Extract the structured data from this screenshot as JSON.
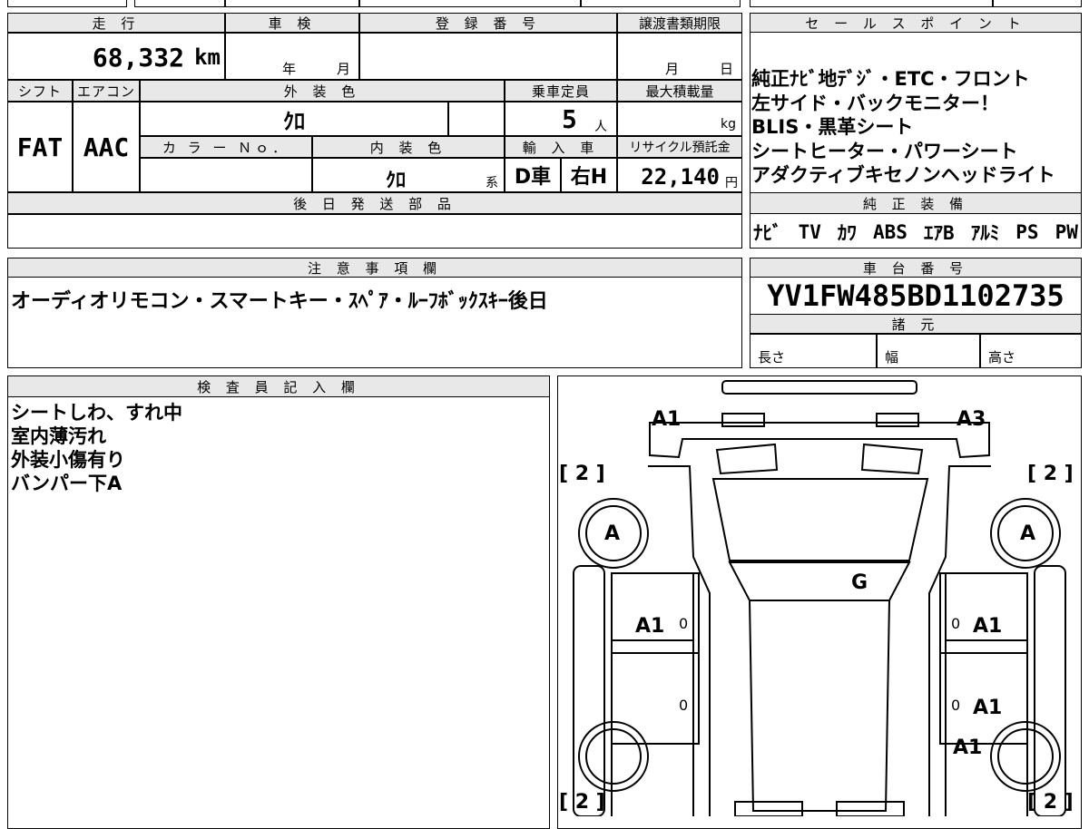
{
  "top_strip": "",
  "vehicle": {
    "mileage_label": "走 行",
    "mileage_value": "68,332",
    "mileage_unit": "km",
    "inspection_label": "車 検",
    "inspection_year": "年",
    "inspection_month": "月",
    "registration_label": "登 録 番 号",
    "transfer_label": "譲渡書類期限",
    "transfer_month": "月",
    "transfer_day": "日",
    "shift_label": "シフト",
    "shift_value": "FAT",
    "ac_label": "エアコン",
    "ac_value": "AAC",
    "exterior_label": "外 装 色",
    "exterior_value": "ｸﾛ",
    "capacity_label": "乗車定員",
    "capacity_value": "5",
    "capacity_unit": "人",
    "load_label": "最大積載量",
    "load_unit": "kg",
    "color_no_label": "カ ラ ー Ｎｏ．",
    "interior_label": "内 装 色",
    "interior_value": "ｸﾛ",
    "interior_suffix": "系",
    "import_label": "輸 入 車",
    "import_d": "D車",
    "import_h": "右H",
    "recycle_label": "リサイクル預託金",
    "recycle_value": "22,140",
    "recycle_unit": "円",
    "later_parts_label": "後 日 発 送 部 品"
  },
  "sales": {
    "label": "セ ー ル ス ポ イ ン ト",
    "lines": [
      "純正ﾅﾋﾞ地ﾃﾞｼﾞ・ETC・フロント",
      "左サイド・バックモニター！",
      "BLIS・黒革シート",
      "シートヒーター・パワーシート",
      "アダクティブキセノンヘッドライト"
    ]
  },
  "equipment": {
    "label": "純 正 装 備",
    "items": [
      "ﾅﾋﾞ",
      "TV",
      "ｶﾜ",
      "ABS",
      "ｴｱB",
      "ｱﾙﾐ",
      "PS",
      "PW"
    ]
  },
  "notes": {
    "label": "注 意 事 項 欄",
    "text": "オーディオリモコン・スマートキー・ｽﾍﾟｱ・ﾙｰﾌﾎﾞｯｸｽｷｰ後日"
  },
  "chassis": {
    "label": "車 台 番 号",
    "value": "YV1FW485BD1102735",
    "spec_label": "諸 元",
    "length_label": "長さ",
    "width_label": "幅",
    "height_label": "高さ"
  },
  "inspector": {
    "label": "検 査 員 記 入 欄",
    "lines": [
      "シートしわ、すれ中",
      "室内薄汚れ",
      "外装小傷有り",
      "バンパー下A"
    ]
  },
  "diagram": {
    "a1_front_left": "A1",
    "a3_front_right": "A3",
    "tire_tl": "[ 2 ]",
    "tire_tr": "[ 2 ]",
    "tire_bl": "[ 2 ]",
    "tire_br": "[ 2 ]",
    "wheel_left": "A",
    "wheel_right": "A",
    "windshield": "G",
    "door_fl": "A1",
    "door_fr": "A1",
    "door_rr": "A1",
    "rear_r": "A1",
    "zero1": "0",
    "zero2": "0",
    "zero3": "0",
    "zero4": "0"
  }
}
